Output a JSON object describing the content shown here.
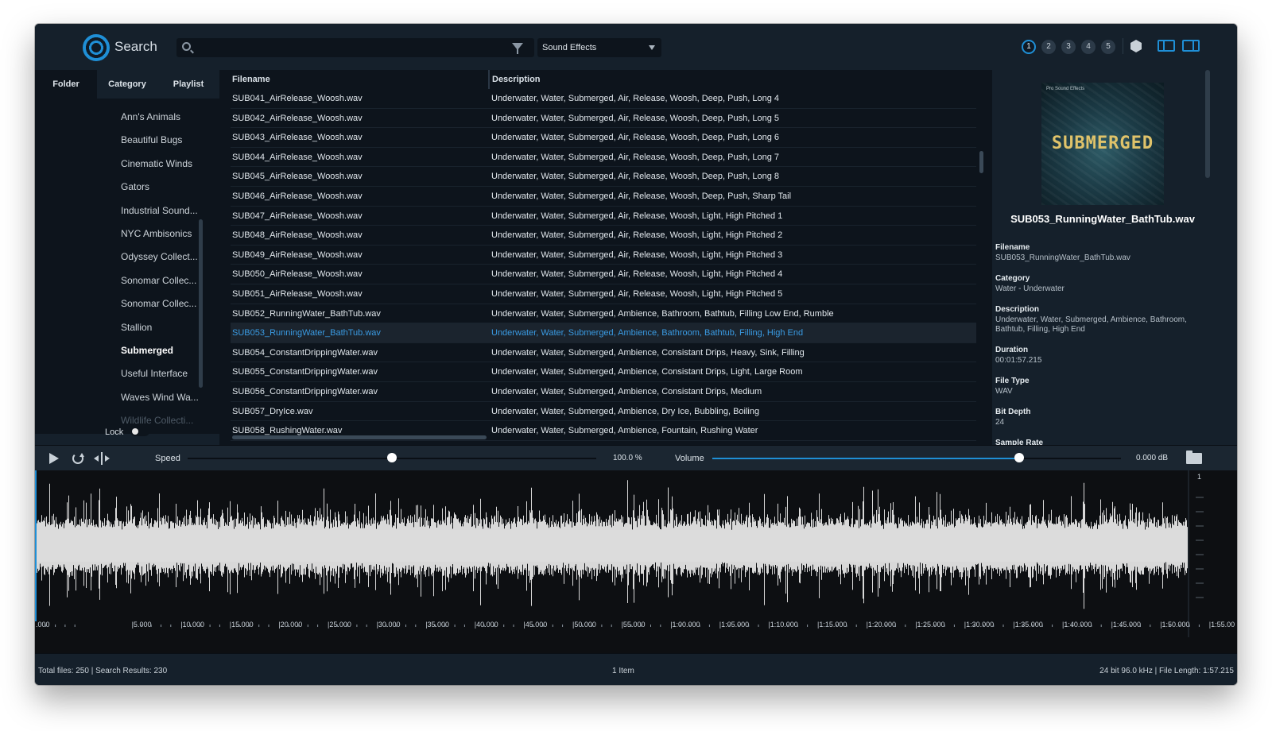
{
  "toolbar": {
    "app_title": "Search",
    "search_placeholder": "",
    "category_select": "Sound Effects",
    "preset_buttons": [
      "1",
      "2",
      "3",
      "4",
      "5"
    ],
    "active_preset": "1"
  },
  "sidebar": {
    "tabs": [
      {
        "label": "Folder",
        "active": true
      },
      {
        "label": "Category",
        "active": false
      },
      {
        "label": "Playlist",
        "active": false
      }
    ],
    "folders": [
      "Ann's Animals",
      "Beautiful Bugs",
      "Cinematic Winds",
      "Gators",
      "Industrial Sound...",
      "NYC Ambisonics",
      "Odyssey Collect...",
      "Sonomar Collec...",
      "Sonomar Collec...",
      "Stallion",
      "Submerged",
      "Useful Interface",
      "Waves Wind Wa...",
      "Wildlife Collecti..."
    ],
    "active_folder": "Submerged",
    "lock_label": "Lock"
  },
  "table": {
    "columns": [
      "Filename",
      "Description"
    ],
    "rows": [
      {
        "filename": "SUB041_AirRelease_Woosh.wav",
        "description": "Underwater, Water, Submerged, Air, Release, Woosh, Deep, Push, Long 4"
      },
      {
        "filename": "SUB042_AirRelease_Woosh.wav",
        "description": "Underwater, Water, Submerged, Air, Release, Woosh, Deep, Push, Long 5"
      },
      {
        "filename": "SUB043_AirRelease_Woosh.wav",
        "description": "Underwater, Water, Submerged, Air, Release, Woosh, Deep, Push, Long 6"
      },
      {
        "filename": "SUB044_AirRelease_Woosh.wav",
        "description": "Underwater, Water, Submerged, Air, Release, Woosh, Deep, Push, Long 7"
      },
      {
        "filename": "SUB045_AirRelease_Woosh.wav",
        "description": "Underwater, Water, Submerged, Air, Release, Woosh, Deep, Push, Long 8"
      },
      {
        "filename": "SUB046_AirRelease_Woosh.wav",
        "description": "Underwater, Water, Submerged, Air, Release, Woosh, Deep, Push, Sharp Tail"
      },
      {
        "filename": "SUB047_AirRelease_Woosh.wav",
        "description": "Underwater, Water, Submerged, Air, Release, Woosh, Light, High Pitched 1"
      },
      {
        "filename": "SUB048_AirRelease_Woosh.wav",
        "description": "Underwater, Water, Submerged, Air, Release, Woosh, Light, High Pitched 2"
      },
      {
        "filename": "SUB049_AirRelease_Woosh.wav",
        "description": "Underwater, Water, Submerged, Air, Release, Woosh, Light, High Pitched 3"
      },
      {
        "filename": "SUB050_AirRelease_Woosh.wav",
        "description": "Underwater, Water, Submerged, Air, Release, Woosh, Light, High Pitched 4"
      },
      {
        "filename": "SUB051_AirRelease_Woosh.wav",
        "description": "Underwater, Water, Submerged, Air, Release, Woosh, Light, High Pitched 5"
      },
      {
        "filename": "SUB052_RunningWater_BathTub.wav",
        "description": "Underwater, Water, Submerged, Ambience, Bathroom, Bathtub, Filling Low End, Rumble"
      },
      {
        "filename": "SUB053_RunningWater_BathTub.wav",
        "description": "Underwater, Water, Submerged, Ambience, Bathroom, Bathtub, Filling, High End"
      },
      {
        "filename": "SUB054_ConstantDrippingWater.wav",
        "description": "Underwater, Water, Submerged, Ambience, Consistant Drips, Heavy, Sink, Filling"
      },
      {
        "filename": "SUB055_ConstantDrippingWater.wav",
        "description": "Underwater, Water, Submerged, Ambience, Consistant Drips, Light, Large Room"
      },
      {
        "filename": "SUB056_ConstantDrippingWater.wav",
        "description": "Underwater, Water, Submerged, Ambience, Consistant Drips, Medium"
      },
      {
        "filename": "SUB057_DryIce.wav",
        "description": "Underwater, Water, Submerged, Ambience, Dry Ice, Bubbling, Boiling"
      },
      {
        "filename": "SUB058_RushingWater.wav",
        "description": "Underwater, Water, Submerged, Ambience, Fountain, Rushing Water"
      }
    ],
    "selected_index": 12
  },
  "info": {
    "album_brand": "Pro Sound Effects",
    "album_title": "SUBMERGED",
    "selected_title": "SUB053_RunningWater_BathTub.wav",
    "fields": [
      {
        "label": "Filename",
        "value": "SUB053_RunningWater_BathTub.wav"
      },
      {
        "label": "Category",
        "value": "Water - Underwater"
      },
      {
        "label": "Description",
        "value": "Underwater, Water, Submerged, Ambience, Bathroom, Bathtub, Filling, High End"
      },
      {
        "label": "Duration",
        "value": "00:01:57.215"
      },
      {
        "label": "File Type",
        "value": "WAV"
      },
      {
        "label": "Bit Depth",
        "value": "24"
      },
      {
        "label": "Sample Rate",
        "value": ""
      }
    ]
  },
  "transport": {
    "speed_label": "Speed",
    "speed_value": "100.0 %",
    "speed_fraction": 0.5,
    "volume_label": "Volume",
    "volume_value": "0.000 dB",
    "volume_fraction": 0.75
  },
  "waveform": {
    "channel_label": "1",
    "time_ticks": [
      ".000",
      "|5.000",
      "|10.000",
      "|15.000",
      "|20.000",
      "|25.000",
      "|30.000",
      "|35.000",
      "|40.000",
      "|45.000",
      "|50.000",
      "|55.000",
      "|1:00.000",
      "|1:05.000",
      "|1:10.000",
      "|1:15.000",
      "|1:20.000",
      "|1:25.000",
      "|1:30.000",
      "|1:35.000",
      "|1:40.000",
      "|1:45.000",
      "|1:50.000",
      "|1:55.00"
    ]
  },
  "status": {
    "left": "Total files: 250  |  Search Results: 230",
    "center": "1 Item",
    "right": "24 bit 96.0 kHz  |  File Length: 1:57.215"
  },
  "colors": {
    "accent": "#1f8fd6",
    "selected_text": "#3a9be3",
    "window_bg": "#15202b",
    "panel_bg": "#0d141c"
  }
}
